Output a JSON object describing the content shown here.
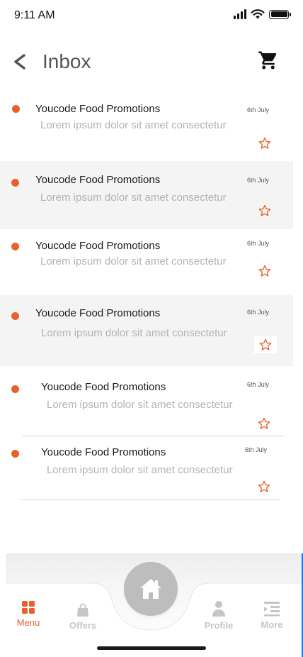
{
  "status": {
    "time": "9:11 AM"
  },
  "header": {
    "title": "Inbox"
  },
  "messages": [
    {
      "sender": "Youcode Food Promotions",
      "preview": "Lorem ipsum dolor sit amet consectetur",
      "date": "6th July"
    },
    {
      "sender": "Youcode Food Promotions",
      "preview": "Lorem ipsum dolor sit amet consectetur",
      "date": "6th July"
    },
    {
      "sender": "Youcode Food Promotions",
      "preview": "Lorem ipsum dolor sit amet consectetur",
      "date": "6th July"
    },
    {
      "sender": "Youcode Food Promotions",
      "preview": "Lorem ipsum dolor sit amet consectetur",
      "date": "6th July"
    },
    {
      "sender": "Youcode Food Promotions",
      "preview": "Lorem ipsum dolor sit amet consectetur",
      "date": "6th July"
    },
    {
      "sender": "Youcode Food Promotions",
      "preview": "Lorem ipsum dolor sit amet consectetur",
      "date": "6th July"
    }
  ],
  "nav": {
    "menu_label": "Menu",
    "offers_label": "Offers",
    "profile_label": "Profile",
    "more_label": "More"
  },
  "colors": {
    "accent": "#e8602c",
    "unread_dot": "#e8602c",
    "inactive_nav": "#c6c6c6",
    "home_button": "#bdbdbd"
  },
  "icons": {
    "back": "back-arrow-icon",
    "cart": "cart-icon",
    "star": "star-outline-icon",
    "menu": "grid-icon",
    "offers": "shopping-bag-icon",
    "home": "home-icon",
    "profile": "person-icon",
    "more": "list-icon"
  }
}
